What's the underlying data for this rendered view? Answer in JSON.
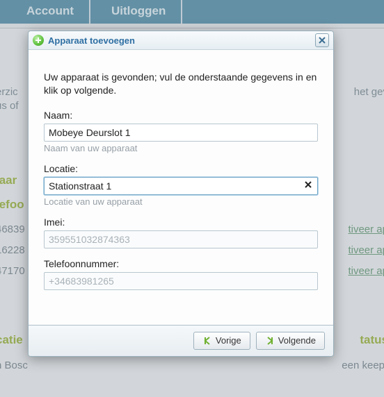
{
  "tabs": {
    "account": "Account",
    "logout": "Uitloggen"
  },
  "background": {
    "l1a": "erzic",
    "l1b": "het gev",
    "l2a": "us of",
    "naam": "laar",
    "tel": "lefoo",
    "r1a": "46839",
    "r1b": "tiveer ap",
    "r2a": "16228",
    "r2b": "tiveer ap",
    "r3a": "47170",
    "r3b": "tiveer ap",
    "loc": "catie",
    "bos": "n Bosc",
    "status": "tatus",
    "keep": "een keep-"
  },
  "modal": {
    "title": "Apparaat toevoegen",
    "intro": "Uw apparaat is gevonden; vul de onderstaande gegevens in en klik op volgende.",
    "fields": {
      "name": {
        "label": "Naam:",
        "value": "Mobeye Deurslot 1",
        "helper": "Naam van uw apparaat"
      },
      "location": {
        "label": "Locatie:",
        "value": "Stationstraat 1",
        "helper": "Locatie van uw apparaat"
      },
      "imei": {
        "label": "Imei:",
        "value": "359551032874363"
      },
      "phone": {
        "label": "Telefoonnummer:",
        "value": "+34683981265"
      }
    },
    "buttons": {
      "prev": "Vorige",
      "next": "Volgende"
    }
  }
}
